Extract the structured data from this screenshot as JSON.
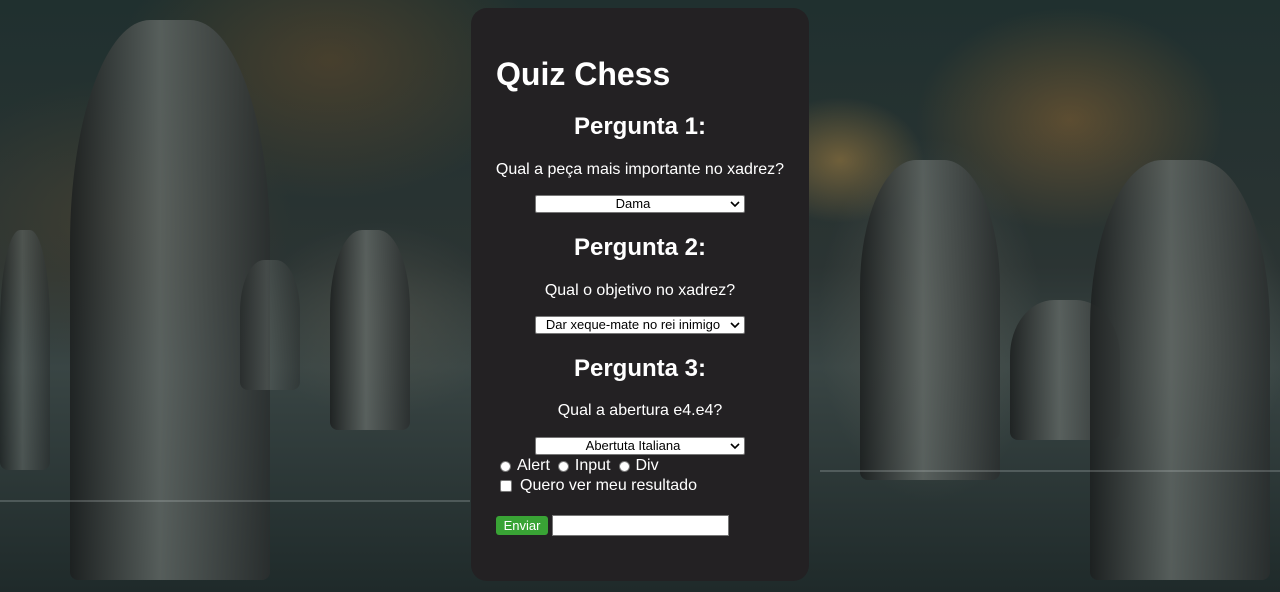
{
  "quiz": {
    "title": "Quiz Chess",
    "questions": [
      {
        "heading": "Pergunta 1:",
        "text": "Qual a peça mais importante no xadrez?",
        "selected": "Dama"
      },
      {
        "heading": "Pergunta 2:",
        "text": "Qual o objetivo no xadrez?",
        "selected": "Dar xeque-mate no rei inimigo"
      },
      {
        "heading": "Pergunta 3:",
        "text": "Qual a abertura e4.e4?",
        "selected": "Abertuta Italiana"
      }
    ],
    "radio_options": [
      "Alert",
      "Input",
      "Div"
    ],
    "checkbox_label": "Quero ver meu resultado",
    "submit_label": "Enviar",
    "text_input_value": ""
  },
  "colors": {
    "card_bg": "#232123",
    "button_bg": "#39a335",
    "text": "#ffffff"
  },
  "icons": [
    "chevron-down-icon"
  ]
}
